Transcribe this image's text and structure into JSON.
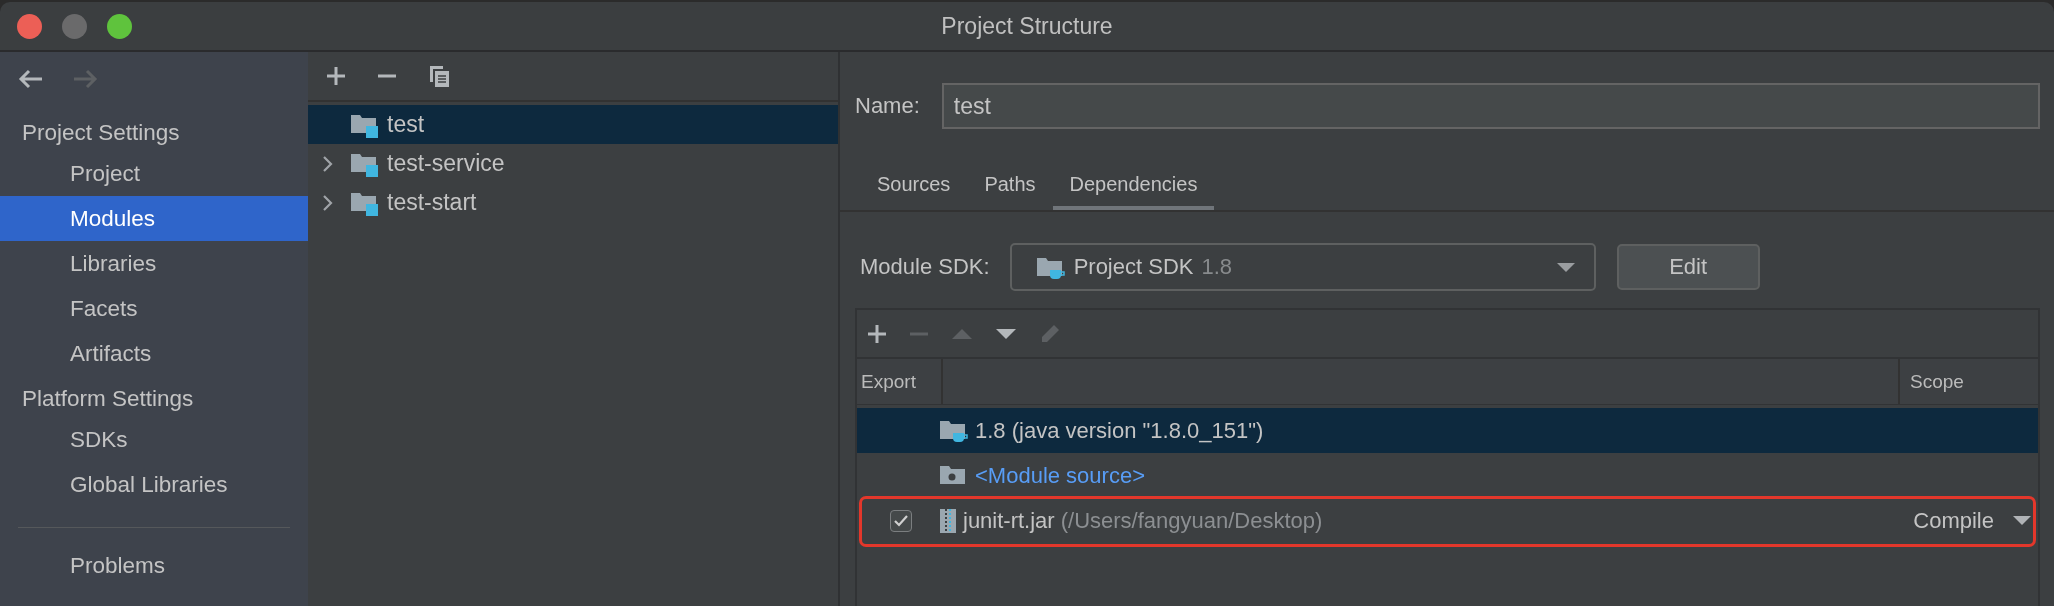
{
  "window": {
    "title": "Project Structure"
  },
  "navigation": [
    {
      "kind": "back",
      "disabled": false
    },
    {
      "kind": "forward",
      "disabled": true
    }
  ],
  "sidebar": {
    "items": [
      {
        "kind": "heading",
        "label": "Project Settings"
      },
      {
        "kind": "item",
        "label": "Project",
        "selected": false
      },
      {
        "kind": "item",
        "label": "Modules",
        "selected": true
      },
      {
        "kind": "item",
        "label": "Libraries",
        "selected": false
      },
      {
        "kind": "item",
        "label": "Facets",
        "selected": false
      },
      {
        "kind": "item",
        "label": "Artifacts",
        "selected": false
      },
      {
        "kind": "heading",
        "label": "Platform Settings"
      },
      {
        "kind": "item",
        "label": "SDKs",
        "selected": false
      },
      {
        "kind": "item",
        "label": "Global Libraries",
        "selected": false
      },
      {
        "kind": "separator"
      },
      {
        "kind": "item",
        "label": "Problems",
        "selected": false
      }
    ]
  },
  "module_toolbar": [
    {
      "kind": "add"
    },
    {
      "kind": "remove"
    },
    {
      "kind": "copy"
    }
  ],
  "modules": [
    {
      "name": "test",
      "selected": true,
      "expandable": false
    },
    {
      "name": "test-service",
      "selected": false,
      "expandable": true
    },
    {
      "name": "test-start",
      "selected": false,
      "expandable": true
    }
  ],
  "editor": {
    "name_label": "Name:",
    "name_value": "test",
    "tabs": [
      {
        "label": "Sources",
        "selected": false
      },
      {
        "label": "Paths",
        "selected": false
      },
      {
        "label": "Dependencies",
        "selected": true
      }
    ],
    "sdk_label": "Module SDK:",
    "sdk_value": "Project SDK",
    "sdk_version": "1.8",
    "edit_button": "Edit",
    "dependency_toolbar": [
      {
        "kind": "add",
        "disabled": false
      },
      {
        "kind": "remove",
        "disabled": true
      },
      {
        "kind": "up",
        "disabled": true
      },
      {
        "kind": "down",
        "disabled": false
      },
      {
        "kind": "edit",
        "disabled": true
      }
    ],
    "columns": {
      "export": "Export",
      "scope": "Scope"
    },
    "dependencies": [
      {
        "kind": "sdk",
        "name": "1.8 (java version \"1.8.0_151\")",
        "selected": true,
        "highlighted": false
      },
      {
        "kind": "source",
        "name": "<Module source>",
        "selected": false,
        "highlighted": false
      },
      {
        "kind": "library",
        "name": "junit-rt.jar",
        "path": "(/Users/fangyuan/Desktop)",
        "exported": true,
        "scope": "Compile",
        "selected": false,
        "highlighted": true
      }
    ]
  }
}
